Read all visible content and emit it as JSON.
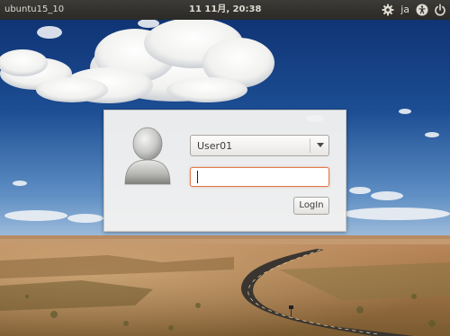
{
  "top_panel": {
    "hostname": "ubuntu15_10",
    "clock": "11 11月, 20:38",
    "language": "ja",
    "indicators": [
      "settings-gear-icon",
      "accessibility-icon",
      "power-icon"
    ]
  },
  "login": {
    "selected_user": "User01",
    "password_value": "",
    "login_button_label": "LogIn",
    "avatar": "default-user-avatar-icon"
  },
  "colors": {
    "panel_bg": "#3c3b37",
    "panel_text": "#dfdbd2",
    "dialog_bg": "#f2f1f0",
    "focus_border": "#e07a4e"
  }
}
